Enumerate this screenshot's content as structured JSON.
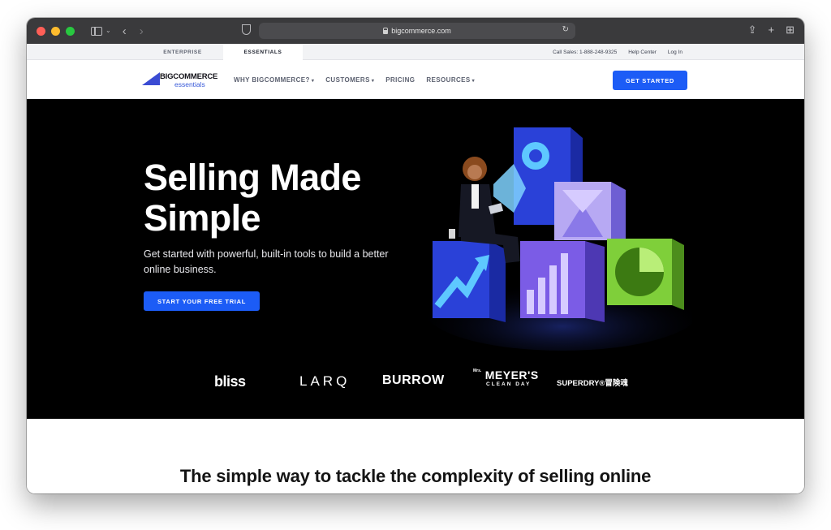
{
  "browser": {
    "url": "bigcommerce.com",
    "traffic_lights": [
      "#ff5f57",
      "#febc2e",
      "#28c840"
    ]
  },
  "utility_bar": {
    "tabs": [
      {
        "label": "ENTERPRISE",
        "active": false
      },
      {
        "label": "ESSENTIALS",
        "active": true
      }
    ],
    "links": [
      "Call Sales: 1-888-248-9325",
      "Help Center",
      "Log In"
    ]
  },
  "nav": {
    "logo_text": "BIGCOMMERCE",
    "logo_sub": "essentials",
    "items": [
      {
        "label": "WHY BIGCOMMERCE?",
        "has_dropdown": true
      },
      {
        "label": "CUSTOMERS",
        "has_dropdown": true
      },
      {
        "label": "PRICING",
        "has_dropdown": false
      },
      {
        "label": "RESOURCES",
        "has_dropdown": true
      }
    ],
    "cta": "GET STARTED"
  },
  "hero": {
    "title_line1": "Selling Made",
    "title_line2": "Simple",
    "subtitle": "Get started with powerful, built-in tools to build a better online business.",
    "cta": "START YOUR FREE TRIAL"
  },
  "customer_logos": {
    "bliss": "bliss",
    "larq": "LARQ",
    "burrow": "BURROW",
    "meyers_prefix": "Mrs.",
    "meyers_main": "MEYER'S",
    "meyers_sub": "CLEAN DAY",
    "superdry": "SUPERDRY®冒険魂"
  },
  "section": {
    "heading": "The simple way to tackle the complexity of selling online"
  },
  "colors": {
    "accent": "#1c5cf6",
    "hero_bg": "#000000",
    "chrome_bg": "#3a3a3c"
  }
}
